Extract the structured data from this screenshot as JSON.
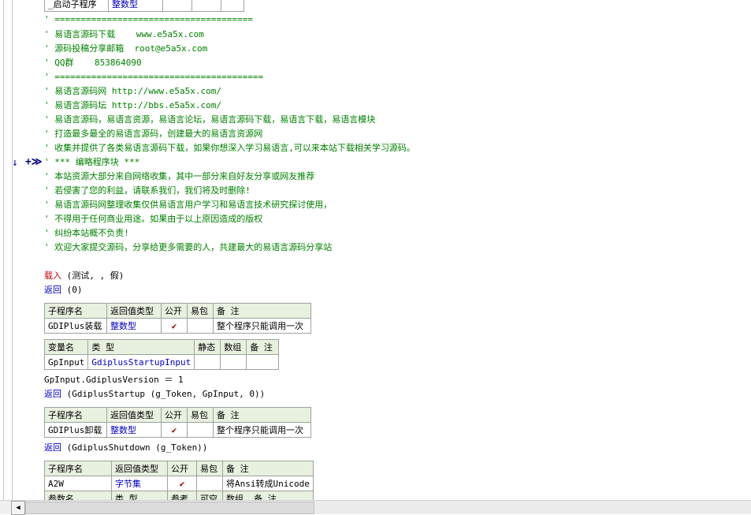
{
  "top_table_row": {
    "name": "_启动子程序",
    "type": "整数型"
  },
  "comments": [
    "' ======================================",
    "' 易语言源码下载    www.e5a5x.com",
    "' 源码投稿分享邮箱  root@e5a5x.com",
    "' QQ群    853864090",
    "' ========================================",
    "' 易语言源码网 http://www.e5a5x.com/",
    "' 易语言源码坛 http://bbs.e5a5x.com/",
    "' 易语言源码，易语言资源，易语言论坛，易语言源码下载，易语言下载，易语言模块",
    "' 打造最多最全的易语言源码，创建最大的易语言资源网",
    "' 收集并提供了各类易语言源码下载，如果你想深入学习易语言,可以来本站下载相关学习源码。",
    "' *** 编略程序块 ***",
    "' 本站资源大部分来自网络收集，其中一部分来自好友分享或网友推荐",
    "' 若侵害了您的利益，请联系我们，我们将及时删除!",
    "' 易语言源码网整理收集仅供易语言用户学习和易语言技术研究探讨使用，",
    "' 不得用于任何商业用途。如果由于以上原因造成的版权",
    "' 纠纷本站概不负责!",
    "' 欢迎大家提交源码，分享给更多需要的人，共建最大的易语言源码分享站"
  ],
  "code1": {
    "kw": "载入",
    "args": " (测试, , 假)"
  },
  "code2": {
    "kw": "返回",
    "args": " (0)"
  },
  "sub_header": {
    "c1": "子程序名",
    "c2": "返回值类型",
    "c3": "公开",
    "c4": "易包",
    "c5": "备 注"
  },
  "var_header": {
    "c1": "变量名",
    "c2": "类 型",
    "c3": "静态",
    "c4": "数组",
    "c5": "备 注"
  },
  "gdi_load": {
    "name": "GDIPlus装载",
    "type": "整数型",
    "note": "整个程序只能调用一次"
  },
  "gp_var": {
    "name": "GpInput",
    "type": "GdiplusStartupInput"
  },
  "code3": "GpInput.GdiplusVersion ＝ 1",
  "code4": {
    "kw": "返回",
    "args": " (GdiplusStartup (g_Token, GpInput, 0))"
  },
  "gdi_unload": {
    "name": "GDIPlus卸载",
    "type": "整数型",
    "note": "整个程序只能调用一次"
  },
  "code5": {
    "kw": "返回",
    "args": " (GdiplusShutdown (g_Token))"
  },
  "a2w": {
    "name": "A2W",
    "type": "字节集",
    "note": "将Ansi转成Unicode"
  },
  "partial_row": {
    "c1": "参数名",
    "c2": "类 型",
    "c3": "参考",
    "c4": "可空",
    "c5": "数组",
    "c6": "备 注"
  },
  "check_mark": "✔",
  "markers": {
    "arrow": "↓",
    "collapse": "+≫"
  },
  "scroll_left": "◀"
}
